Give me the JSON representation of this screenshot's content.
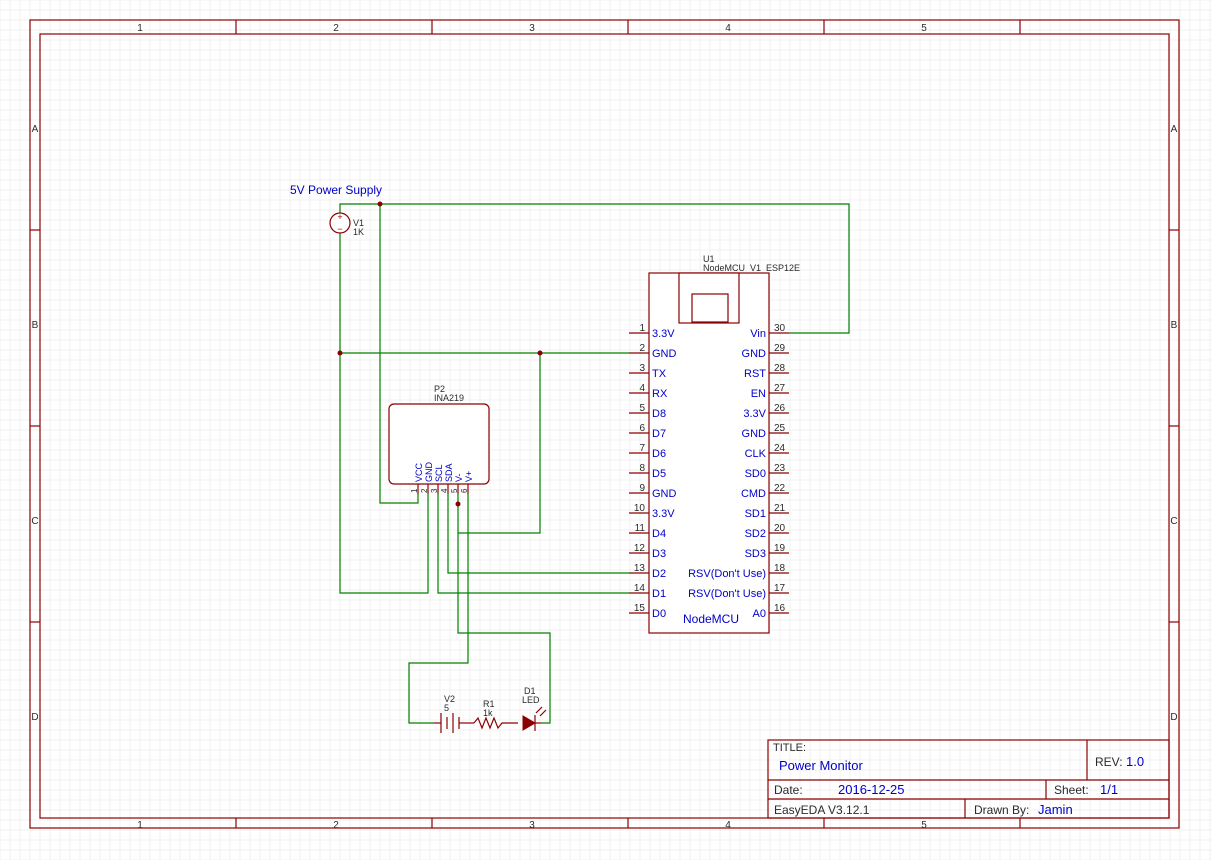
{
  "title_block": {
    "title_label": "TITLE:",
    "title": "Power Monitor",
    "rev_label": "REV:",
    "rev": "1.0",
    "date_label": "Date:",
    "date": "2016-12-25",
    "sheet_label": "Sheet:",
    "sheet": "1/1",
    "tool": "EasyEDA V3.12.1",
    "drawn_label": "Drawn By:",
    "drawn_by": "Jamin"
  },
  "frame": {
    "col_labels": [
      "1",
      "2",
      "3",
      "4",
      "5"
    ],
    "row_labels": [
      "A",
      "B",
      "C",
      "D"
    ]
  },
  "power_supply": {
    "label": "5V Power Supply",
    "designator": "V1",
    "value": "1K",
    "plus": "+",
    "minus": "−"
  },
  "mcu": {
    "designator": "U1",
    "part": "NodeMCU_V1_ESP12E",
    "name": "NodeMCU",
    "left_pins": [
      {
        "num": "1",
        "name": "3.3V"
      },
      {
        "num": "2",
        "name": "GND"
      },
      {
        "num": "3",
        "name": "TX"
      },
      {
        "num": "4",
        "name": "RX"
      },
      {
        "num": "5",
        "name": "D8"
      },
      {
        "num": "6",
        "name": "D7"
      },
      {
        "num": "7",
        "name": "D6"
      },
      {
        "num": "8",
        "name": "D5"
      },
      {
        "num": "9",
        "name": "GND"
      },
      {
        "num": "10",
        "name": "3.3V"
      },
      {
        "num": "11",
        "name": "D4"
      },
      {
        "num": "12",
        "name": "D3"
      },
      {
        "num": "13",
        "name": "D2"
      },
      {
        "num": "14",
        "name": "D1"
      },
      {
        "num": "15",
        "name": "D0"
      }
    ],
    "right_pins": [
      {
        "num": "30",
        "name": "Vin"
      },
      {
        "num": "29",
        "name": "GND"
      },
      {
        "num": "28",
        "name": "RST"
      },
      {
        "num": "27",
        "name": "EN"
      },
      {
        "num": "26",
        "name": "3.3V"
      },
      {
        "num": "25",
        "name": "GND"
      },
      {
        "num": "24",
        "name": "CLK"
      },
      {
        "num": "23",
        "name": "SD0"
      },
      {
        "num": "22",
        "name": "CMD"
      },
      {
        "num": "21",
        "name": "SD1"
      },
      {
        "num": "20",
        "name": "SD2"
      },
      {
        "num": "19",
        "name": "SD3"
      },
      {
        "num": "18",
        "name": "RSV(Don't Use)"
      },
      {
        "num": "17",
        "name": "RSV(Don't Use)"
      },
      {
        "num": "16",
        "name": "A0"
      }
    ]
  },
  "ina": {
    "designator": "P2",
    "part": "INA219",
    "pins": [
      {
        "num": "1",
        "name": "VCC"
      },
      {
        "num": "2",
        "name": "GND"
      },
      {
        "num": "3",
        "name": "SCL"
      },
      {
        "num": "4",
        "name": "SDA"
      },
      {
        "num": "5",
        "name": "V-"
      },
      {
        "num": "6",
        "name": "V+"
      }
    ]
  },
  "battery": {
    "designator": "V2",
    "value": "5"
  },
  "resistor": {
    "designator": "R1",
    "value": "1k"
  },
  "led": {
    "designator": "D1",
    "value": "LED"
  }
}
